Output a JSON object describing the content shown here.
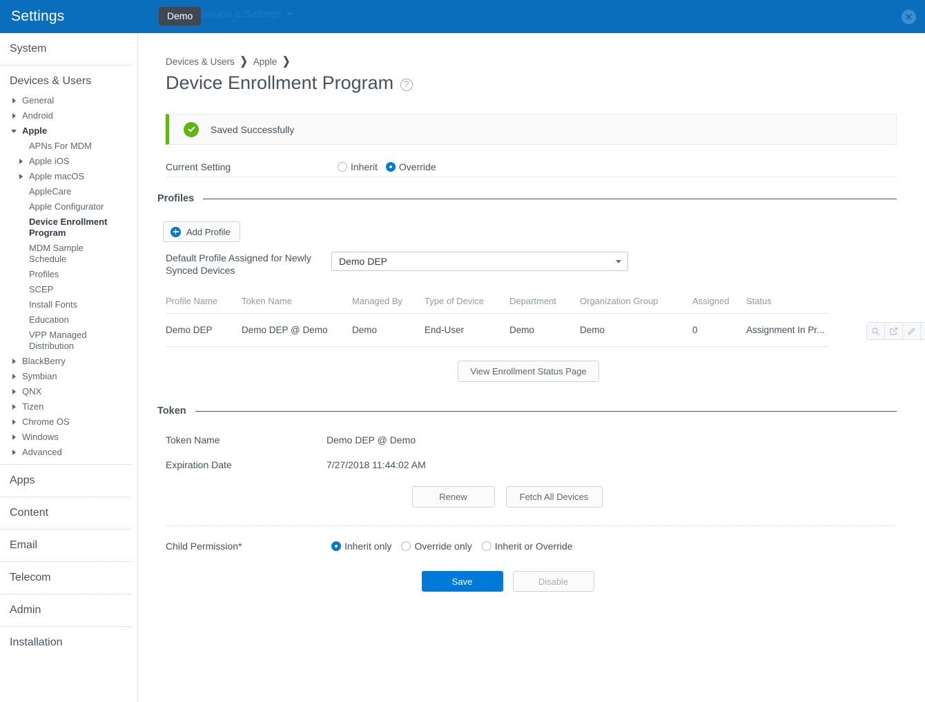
{
  "topbar": {
    "title": "Settings",
    "menu_label": "Groups & Settings",
    "tooltip": "Demo",
    "close_icon": "close-circle-icon",
    "brand_color": "#0a6ebd"
  },
  "sidebar": {
    "sections": [
      {
        "label": "System",
        "type": "section"
      },
      {
        "label": "Devices & Users",
        "type": "group-head"
      }
    ],
    "devices_items": [
      {
        "label": "General",
        "level": 1,
        "state": "closed"
      },
      {
        "label": "Android",
        "level": 1,
        "state": "closed"
      },
      {
        "label": "Apple",
        "level": 1,
        "state": "open",
        "bold": true
      },
      {
        "label": "APNs For MDM",
        "level": 2,
        "state": "none"
      },
      {
        "label": "Apple iOS",
        "level": 2,
        "state": "closed"
      },
      {
        "label": "Apple macOS",
        "level": 2,
        "state": "closed"
      },
      {
        "label": "AppleCare",
        "level": 2,
        "state": "none"
      },
      {
        "label": "Apple Configurator",
        "level": 2,
        "state": "none"
      },
      {
        "label": "Device Enrollment Program",
        "level": 2,
        "state": "none",
        "selected": true
      },
      {
        "label": "MDM Sample Schedule",
        "level": 2,
        "state": "none"
      },
      {
        "label": "Profiles",
        "level": 2,
        "state": "none"
      },
      {
        "label": "SCEP",
        "level": 2,
        "state": "none"
      },
      {
        "label": "Install Fonts",
        "level": 2,
        "state": "none"
      },
      {
        "label": "Education",
        "level": 2,
        "state": "none"
      },
      {
        "label": "VPP Managed Distribution",
        "level": 2,
        "state": "none"
      },
      {
        "label": "BlackBerry",
        "level": 1,
        "state": "closed"
      },
      {
        "label": "Symbian",
        "level": 1,
        "state": "closed"
      },
      {
        "label": "QNX",
        "level": 1,
        "state": "closed"
      },
      {
        "label": "Tizen",
        "level": 1,
        "state": "closed"
      },
      {
        "label": "Chrome OS",
        "level": 1,
        "state": "closed"
      },
      {
        "label": "Windows",
        "level": 1,
        "state": "closed"
      },
      {
        "label": "Advanced",
        "level": 1,
        "state": "closed"
      }
    ],
    "bottom_sections": [
      {
        "label": "Apps"
      },
      {
        "label": "Content"
      },
      {
        "label": "Email"
      },
      {
        "label": "Telecom"
      },
      {
        "label": "Admin"
      },
      {
        "label": "Installation"
      }
    ]
  },
  "main": {
    "breadcrumb": [
      "Devices & Users",
      "Apple"
    ],
    "page_title": "Device Enrollment Program",
    "help_icon": "help-circle-icon",
    "alert": {
      "text": "Saved Successfully",
      "icon": "check-circle-icon",
      "color": "#60b515"
    },
    "current_setting": {
      "label": "Current Setting",
      "options": [
        {
          "label": "Inherit",
          "selected": false
        },
        {
          "label": "Override",
          "selected": true
        }
      ]
    },
    "profiles": {
      "section_title": "Profiles",
      "add_button": "Add Profile",
      "add_icon": "plus-circle-icon",
      "default_profile_label": "Default Profile Assigned for Newly Synced Devices",
      "default_profile_value": "Demo DEP",
      "table": {
        "columns": [
          "Profile Name",
          "Token Name",
          "Managed By",
          "Type of Device",
          "Department",
          "Organization Group",
          "Assigned",
          "Status"
        ],
        "rows": [
          {
            "profile_name": "Demo DEP",
            "token_name": "Demo DEP @ Demo",
            "managed_by": "Demo",
            "type_of_device": "End-User",
            "department": "Demo",
            "organization_group": "Demo",
            "assigned": "0",
            "status": "Assignment In Pr..."
          }
        ],
        "row_actions": [
          "search-icon",
          "edit-square-icon",
          "pencil-icon",
          "chevron-down-icon"
        ]
      },
      "view_status_button": "View Enrollment Status Page"
    },
    "token": {
      "section_title": "Token",
      "token_name_label": "Token Name",
      "token_name_value": "Demo DEP @ Demo",
      "expiration_label": "Expiration Date",
      "expiration_value": "7/27/2018 11:44:02 AM",
      "renew_button": "Renew",
      "fetch_button": "Fetch All Devices"
    },
    "child_permission": {
      "label": "Child Permission*",
      "options": [
        {
          "label": "Inherit only",
          "selected": true
        },
        {
          "label": "Override only",
          "selected": false
        },
        {
          "label": "Inherit or Override",
          "selected": false
        }
      ]
    },
    "footer": {
      "save_button": "Save",
      "disable_button": "Disable"
    }
  }
}
